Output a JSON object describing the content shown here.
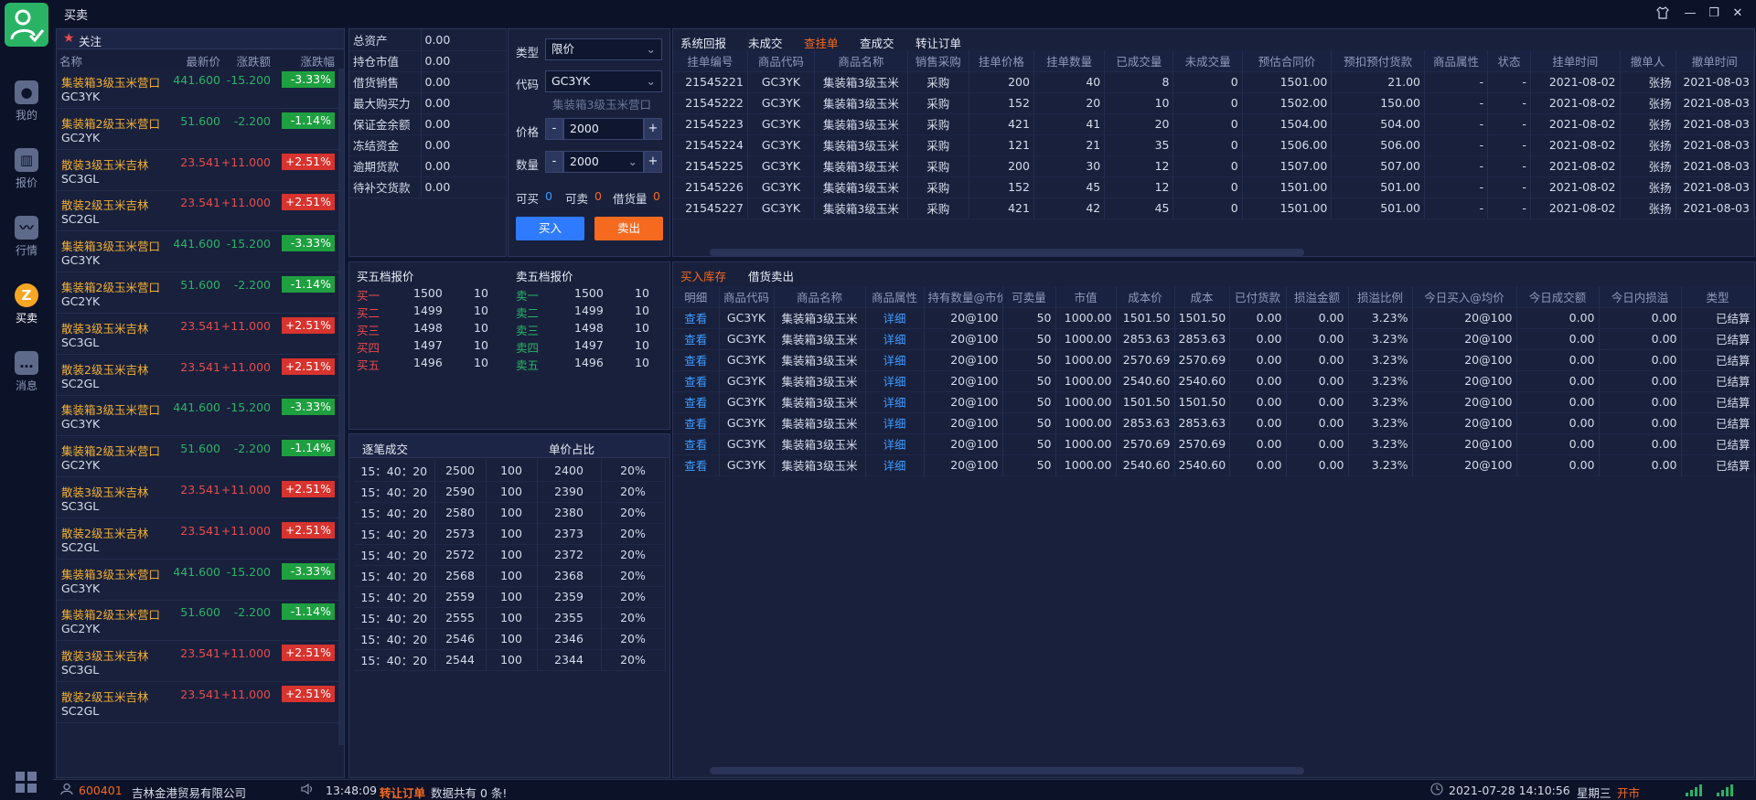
{
  "titlebar": {
    "title": "买卖"
  },
  "nav": {
    "items": [
      {
        "label": "我的",
        "icon": "user-icon"
      },
      {
        "label": "报价",
        "icon": "bar-chart-icon"
      },
      {
        "label": "行情",
        "icon": "line-chart-icon"
      },
      {
        "label": "买卖",
        "icon": "trade-icon"
      },
      {
        "label": "消息",
        "icon": "message-icon"
      }
    ]
  },
  "watchlist": {
    "title": "关注",
    "headers": {
      "name": "名称",
      "price": "最新价",
      "change": "涨跌额",
      "pct": "涨跌幅"
    },
    "rows": [
      {
        "name": "集装箱3级玉米营口",
        "code": "GC3YK",
        "price": "441.600",
        "change": "-15.200",
        "pct": "-3.33%",
        "dir": "dn"
      },
      {
        "name": "集装箱2级玉米营口",
        "code": "GC2YK",
        "price": "51.600",
        "change": "-2.200",
        "pct": "-1.14%",
        "dir": "dn"
      },
      {
        "name": "散装3级玉米吉林",
        "code": "SC3GL",
        "price": "23.541",
        "change": "+11.000",
        "pct": "+2.51%",
        "dir": "up"
      },
      {
        "name": "散装2级玉米吉林",
        "code": "SC2GL",
        "price": "23.541",
        "change": "+11.000",
        "pct": "+2.51%",
        "dir": "up"
      },
      {
        "name": "集装箱3级玉米营口",
        "code": "GC3YK",
        "price": "441.600",
        "change": "-15.200",
        "pct": "-3.33%",
        "dir": "dn"
      },
      {
        "name": "集装箱2级玉米营口",
        "code": "GC2YK",
        "price": "51.600",
        "change": "-2.200",
        "pct": "-1.14%",
        "dir": "dn"
      },
      {
        "name": "散装3级玉米吉林",
        "code": "SC3GL",
        "price": "23.541",
        "change": "+11.000",
        "pct": "+2.51%",
        "dir": "up"
      },
      {
        "name": "散装2级玉米吉林",
        "code": "SC2GL",
        "price": "23.541",
        "change": "+11.000",
        "pct": "+2.51%",
        "dir": "up"
      },
      {
        "name": "集装箱3级玉米营口",
        "code": "GC3YK",
        "price": "441.600",
        "change": "-15.200",
        "pct": "-3.33%",
        "dir": "dn"
      },
      {
        "name": "集装箱2级玉米营口",
        "code": "GC2YK",
        "price": "51.600",
        "change": "-2.200",
        "pct": "-1.14%",
        "dir": "dn"
      },
      {
        "name": "散装3级玉米吉林",
        "code": "SC3GL",
        "price": "23.541",
        "change": "+11.000",
        "pct": "+2.51%",
        "dir": "up"
      },
      {
        "name": "散装2级玉米吉林",
        "code": "SC2GL",
        "price": "23.541",
        "change": "+11.000",
        "pct": "+2.51%",
        "dir": "up"
      },
      {
        "name": "集装箱3级玉米营口",
        "code": "GC3YK",
        "price": "441.600",
        "change": "-15.200",
        "pct": "-3.33%",
        "dir": "dn"
      },
      {
        "name": "集装箱2级玉米营口",
        "code": "GC2YK",
        "price": "51.600",
        "change": "-2.200",
        "pct": "-1.14%",
        "dir": "dn"
      },
      {
        "name": "散装3级玉米吉林",
        "code": "SC3GL",
        "price": "23.541",
        "change": "+11.000",
        "pct": "+2.51%",
        "dir": "up"
      },
      {
        "name": "散装2级玉米吉林",
        "code": "SC2GL",
        "price": "23.541",
        "change": "+11.000",
        "pct": "+2.51%",
        "dir": "up"
      }
    ]
  },
  "account": {
    "rows": [
      {
        "label": "总资产",
        "value": "0.00"
      },
      {
        "label": "持仓市值",
        "value": "0.00"
      },
      {
        "label": "借货销售",
        "value": "0.00"
      },
      {
        "label": "最大购买力",
        "value": "0.00"
      },
      {
        "label": "保证金余额",
        "value": "0.00"
      },
      {
        "label": "冻结资金",
        "value": "0.00"
      },
      {
        "label": "逾期货款",
        "value": "0.00"
      },
      {
        "label": "待补交货款",
        "value": "0.00"
      }
    ]
  },
  "order": {
    "type_label": "类型",
    "type_value": "限价",
    "code_label": "代码",
    "code_value": "GC3YK",
    "code_hint": "集装箱3级玉米营口",
    "price_label": "价格",
    "price_value": "2000",
    "qty_label": "数量",
    "qty_value": "2000",
    "minus": "-",
    "plus": "+",
    "can_buy_label": "可买",
    "can_buy_value": "0",
    "can_sell_label": "可卖",
    "can_sell_value": "0",
    "borrow_label": "借货量",
    "borrow_value": "0",
    "buy_button": "买入",
    "sell_button": "卖出"
  },
  "orderbook": {
    "buy_title": "买五档报价",
    "sell_title": "卖五档报价",
    "buy": [
      {
        "label": "买一",
        "price": "1500",
        "qty": "10"
      },
      {
        "label": "买二",
        "price": "1499",
        "qty": "10"
      },
      {
        "label": "买三",
        "price": "1498",
        "qty": "10"
      },
      {
        "label": "买四",
        "price": "1497",
        "qty": "10"
      },
      {
        "label": "买五",
        "price": "1496",
        "qty": "10"
      }
    ],
    "sell": [
      {
        "label": "卖一",
        "price": "1500",
        "qty": "10"
      },
      {
        "label": "卖二",
        "price": "1499",
        "qty": "10"
      },
      {
        "label": "卖三",
        "price": "1498",
        "qty": "10"
      },
      {
        "label": "卖四",
        "price": "1497",
        "qty": "10"
      },
      {
        "label": "卖五",
        "price": "1496",
        "qty": "10"
      }
    ]
  },
  "ticks": {
    "title": "逐笔成交",
    "ratio_title": "单价占比",
    "rows": [
      [
        "15：40：20",
        "2500",
        "100",
        "2400",
        "20%"
      ],
      [
        "15：40：20",
        "2590",
        "100",
        "2390",
        "20%"
      ],
      [
        "15：40：20",
        "2580",
        "100",
        "2380",
        "20%"
      ],
      [
        "15：40：20",
        "2573",
        "100",
        "2373",
        "20%"
      ],
      [
        "15：40：20",
        "2572",
        "100",
        "2372",
        "20%"
      ],
      [
        "15：40：20",
        "2568",
        "100",
        "2368",
        "20%"
      ],
      [
        "15：40：20",
        "2559",
        "100",
        "2359",
        "20%"
      ],
      [
        "15：40：20",
        "2555",
        "100",
        "2355",
        "20%"
      ],
      [
        "15：40：20",
        "2546",
        "100",
        "2346",
        "20%"
      ],
      [
        "15：40：20",
        "2544",
        "100",
        "2344",
        "20%"
      ]
    ]
  },
  "orders_panel": {
    "tabs": [
      "系统回报",
      "未成交",
      "查挂单",
      "查成交",
      "转让订单"
    ],
    "active_tab": 2,
    "headers": [
      "挂单编号",
      "商品代码",
      "商品名称",
      "销售采购",
      "挂单价格",
      "挂单数量",
      "已成交量",
      "未成交量",
      "预估合同价",
      "预扣预付货款",
      "商品属性",
      "状态",
      "挂单时间",
      "撤单人",
      "撤单时间"
    ],
    "rows": [
      [
        "21545221",
        "GC3YK",
        "集装箱3级玉米",
        "采购",
        "200",
        "40",
        "8",
        "0",
        "1501.00",
        "21.00",
        "-",
        "-",
        "2021-08-02",
        "张扬",
        "2021-08-03"
      ],
      [
        "21545222",
        "GC3YK",
        "集装箱3级玉米",
        "采购",
        "152",
        "20",
        "10",
        "0",
        "1502.00",
        "150.00",
        "-",
        "-",
        "2021-08-02",
        "张扬",
        "2021-08-03"
      ],
      [
        "21545223",
        "GC3YK",
        "集装箱3级玉米",
        "采购",
        "421",
        "41",
        "20",
        "0",
        "1504.00",
        "504.00",
        "-",
        "-",
        "2021-08-02",
        "张扬",
        "2021-08-03"
      ],
      [
        "21545224",
        "GC3YK",
        "集装箱3级玉米",
        "采购",
        "121",
        "21",
        "35",
        "0",
        "1506.00",
        "506.00",
        "-",
        "-",
        "2021-08-02",
        "张扬",
        "2021-08-03"
      ],
      [
        "21545225",
        "GC3YK",
        "集装箱3级玉米",
        "采购",
        "200",
        "30",
        "12",
        "0",
        "1507.00",
        "507.00",
        "-",
        "-",
        "2021-08-02",
        "张扬",
        "2021-08-03"
      ],
      [
        "21545226",
        "GC3YK",
        "集装箱3级玉米",
        "采购",
        "152",
        "45",
        "12",
        "0",
        "1501.00",
        "501.00",
        "-",
        "-",
        "2021-08-02",
        "张扬",
        "2021-08-03"
      ],
      [
        "21545227",
        "GC3YK",
        "集装箱3级玉米",
        "采购",
        "421",
        "42",
        "45",
        "0",
        "1501.00",
        "501.00",
        "-",
        "-",
        "2021-08-02",
        "张扬",
        "2021-08-03"
      ]
    ]
  },
  "inventory_panel": {
    "tabs": [
      "买入库存",
      "借货卖出"
    ],
    "active_tab": 0,
    "headers": [
      "明细",
      "商品代码",
      "商品名称",
      "商品属性",
      "持有数量@市价",
      "可卖量",
      "市值",
      "成本价",
      "成本",
      "已付货款",
      "损溢金额",
      "损溢比例",
      "今日买入@均价",
      "今日成交额",
      "今日内损溢",
      "类型"
    ],
    "rows": [
      [
        "查看",
        "GC3YK",
        "集装箱3级玉米",
        "详细",
        "20@100",
        "50",
        "1000.00",
        "1501.50",
        "1501.50",
        "0.00",
        "0.00",
        "3.23%",
        "20@100",
        "0.00",
        "0.00",
        "已结算"
      ],
      [
        "查看",
        "GC3YK",
        "集装箱3级玉米",
        "详细",
        "20@100",
        "50",
        "1000.00",
        "2853.63",
        "2853.63",
        "0.00",
        "0.00",
        "3.23%",
        "20@100",
        "0.00",
        "0.00",
        "已结算"
      ],
      [
        "查看",
        "GC3YK",
        "集装箱3级玉米",
        "详细",
        "20@100",
        "50",
        "1000.00",
        "2570.69",
        "2570.69",
        "0.00",
        "0.00",
        "3.23%",
        "20@100",
        "0.00",
        "0.00",
        "已结算"
      ],
      [
        "查看",
        "GC3YK",
        "集装箱3级玉米",
        "详细",
        "20@100",
        "50",
        "1000.00",
        "2540.60",
        "2540.60",
        "0.00",
        "0.00",
        "3.23%",
        "20@100",
        "0.00",
        "0.00",
        "已结算"
      ],
      [
        "查看",
        "GC3YK",
        "集装箱3级玉米",
        "详细",
        "20@100",
        "50",
        "1000.00",
        "1501.50",
        "1501.50",
        "0.00",
        "0.00",
        "3.23%",
        "20@100",
        "0.00",
        "0.00",
        "已结算"
      ],
      [
        "查看",
        "GC3YK",
        "集装箱3级玉米",
        "详细",
        "20@100",
        "50",
        "1000.00",
        "2853.63",
        "2853.63",
        "0.00",
        "0.00",
        "3.23%",
        "20@100",
        "0.00",
        "0.00",
        "已结算"
      ],
      [
        "查看",
        "GC3YK",
        "集装箱3级玉米",
        "详细",
        "20@100",
        "50",
        "1000.00",
        "2570.69",
        "2570.69",
        "0.00",
        "0.00",
        "3.23%",
        "20@100",
        "0.00",
        "0.00",
        "已结算"
      ],
      [
        "查看",
        "GC3YK",
        "集装箱3级玉米",
        "详细",
        "20@100",
        "50",
        "1000.00",
        "2540.60",
        "2540.60",
        "0.00",
        "0.00",
        "3.23%",
        "20@100",
        "0.00",
        "0.00",
        "已结算"
      ]
    ]
  },
  "status": {
    "account_id": "600401",
    "company": "吉林金港贸易有限公司",
    "msg_time": "13:48:09",
    "msg_highlight": "转让订单",
    "msg_rest": "数据共有 0 条!",
    "datetime": "2021-07-28 14:10:56",
    "weekday": "星期三",
    "market": "开市"
  },
  "colors": {
    "accent": "#f56a1f",
    "buy_button": "#2f7bff",
    "sell_button": "#f56a1f",
    "up": "#e74c4c",
    "down": "#2ab365",
    "bg": "#0f1730"
  }
}
